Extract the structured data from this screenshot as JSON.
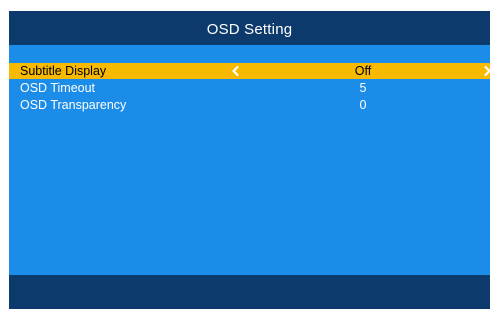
{
  "header": {
    "title": "OSD Setting"
  },
  "menu": {
    "items": [
      {
        "label": "Subtitle Display",
        "value": "Off",
        "selected": true
      },
      {
        "label": "OSD Timeout",
        "value": "5",
        "selected": false
      },
      {
        "label": "OSD Transparency",
        "value": "0",
        "selected": false
      }
    ],
    "left_arrow_icon": "chevron-left-icon",
    "right_arrow_icon": "chevron-right-icon"
  },
  "colors": {
    "background": "#1b8de8",
    "header_footer": "#0c3a6c",
    "highlight": "#f7ba00",
    "text": "#ffffff",
    "selected_text": "#000000"
  }
}
